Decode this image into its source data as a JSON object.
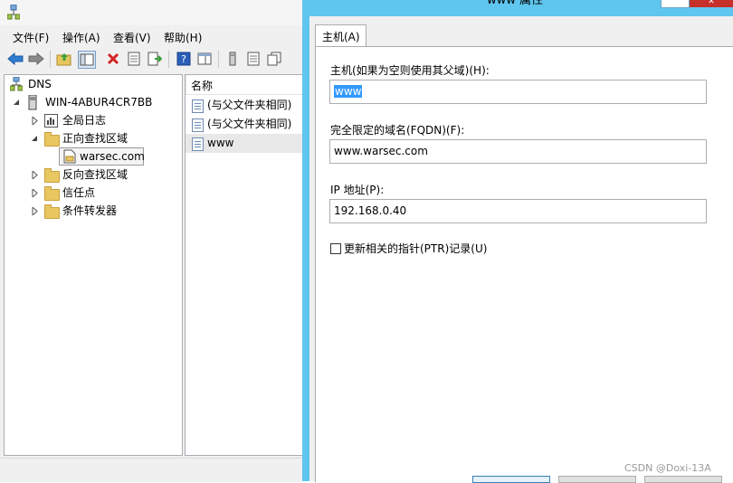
{
  "dns_manager": {
    "menu": [
      {
        "label": "文件(F)"
      },
      {
        "label": "操作(A)"
      },
      {
        "label": "查看(V)"
      },
      {
        "label": "帮助(H)"
      }
    ],
    "tree": {
      "root": "DNS",
      "server": "WIN-4ABUR4CR7BB",
      "global_log": "全局日志",
      "forward_zones": "正向查找区域",
      "zone": "warsec.com",
      "reverse_zones": "反向查找区域",
      "trust_points": "信任点",
      "conditional_forwarders": "条件转发器"
    },
    "list": {
      "column_header": "名称",
      "rows": [
        {
          "name": "(与父文件夹相同)"
        },
        {
          "name": "(与父文件夹相同)"
        },
        {
          "name": "www"
        }
      ]
    }
  },
  "dialog": {
    "title": "www 属性",
    "tab": "主机(A)",
    "host_label": "主机(如果为空则使用其父域)(H):",
    "host_value": "www",
    "fqdn_label": "完全限定的域名(FQDN)(F):",
    "fqdn_value": "www.warsec.com",
    "ip_label": "IP 地址(P):",
    "ip_value": "192.168.0.40",
    "ptr_checkbox_label": "更新相关的指针(PTR)记录(U)",
    "ptr_checked": false,
    "close_symbol": "✕"
  },
  "watermark": "CSDN @Doxi-13A",
  "colors": {
    "dialog_frame": "#5fc6ef",
    "close_button": "#c7302b",
    "selection": "#3399ff"
  }
}
